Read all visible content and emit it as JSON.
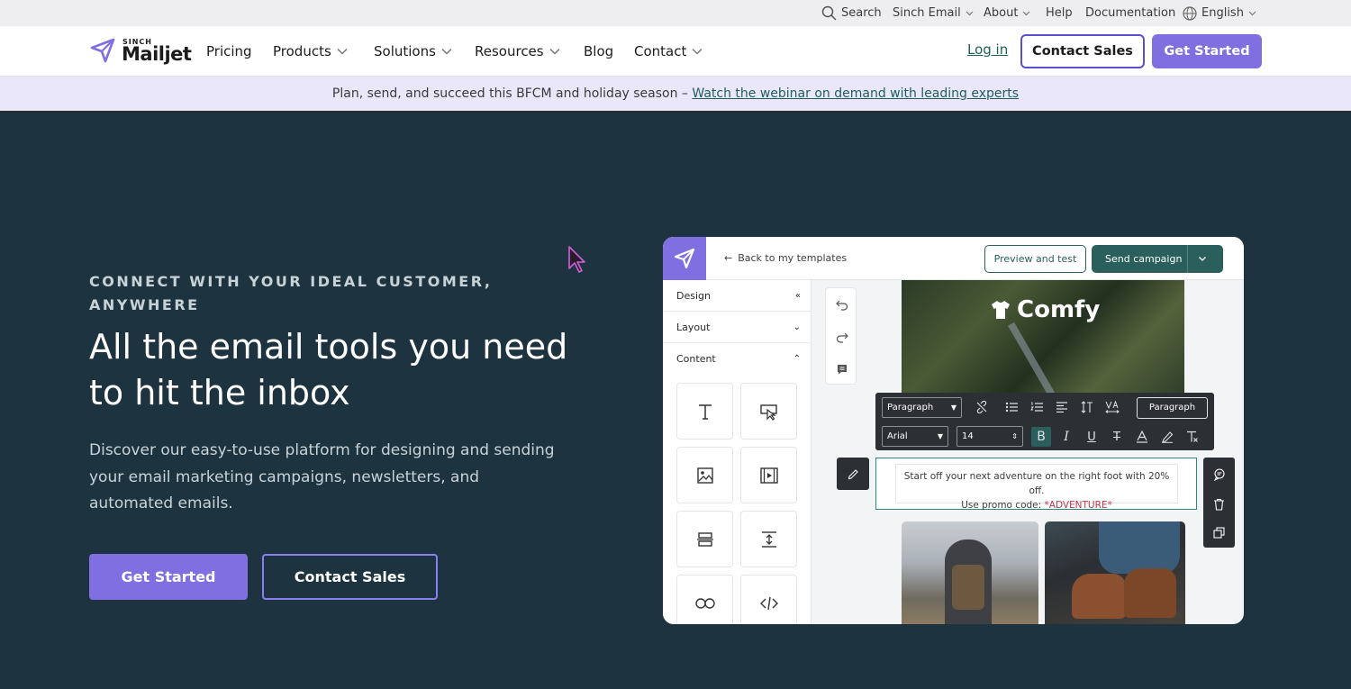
{
  "utility_bar": {
    "search": "Search",
    "sinch_email": "Sinch Email",
    "about": "About",
    "help": "Help",
    "documentation": "Documentation",
    "language": "English"
  },
  "nav": {
    "logo_sinch": "SINCH",
    "logo_word": "Mailjet",
    "items": [
      "Pricing",
      "Products",
      "Solutions",
      "Resources",
      "Blog",
      "Contact"
    ],
    "login": "Log in",
    "contact_sales": "Contact Sales",
    "get_started": "Get Started"
  },
  "banner": {
    "text": "Plan, send, and succeed this BFCM and holiday season – ",
    "link": "Watch the webinar on demand with leading experts"
  },
  "hero": {
    "eyebrow": "CONNECT WITH YOUR IDEAL CUSTOMER, ANYWHERE",
    "headline": "All the email tools you need to hit the inbox",
    "subtext": "Discover our easy-to-use platform for designing and sending your email marketing campaigns, newsletters, and automated emails.",
    "get_started": "Get Started",
    "contact_sales": "Contact Sales"
  },
  "app": {
    "back": "Back to my templates",
    "preview": "Preview and test",
    "send": "Send campaign",
    "sidebar": {
      "design": "Design",
      "layout": "Layout",
      "content": "Content"
    },
    "brand": "Comfy",
    "toolbar": {
      "paragraph_select": "Paragraph",
      "font": "Arial",
      "size": "14",
      "paragraph_button": "Paragraph"
    },
    "text_block": {
      "line1": "Start off your next adventure on the right foot with 20% off.",
      "line2_prefix": "Use promo code: ",
      "promo": "*ADVENTURE*"
    }
  },
  "colors": {
    "accent": "#7f6fe0",
    "hero_bg": "#1d3440",
    "teal": "#2a5f5c"
  }
}
